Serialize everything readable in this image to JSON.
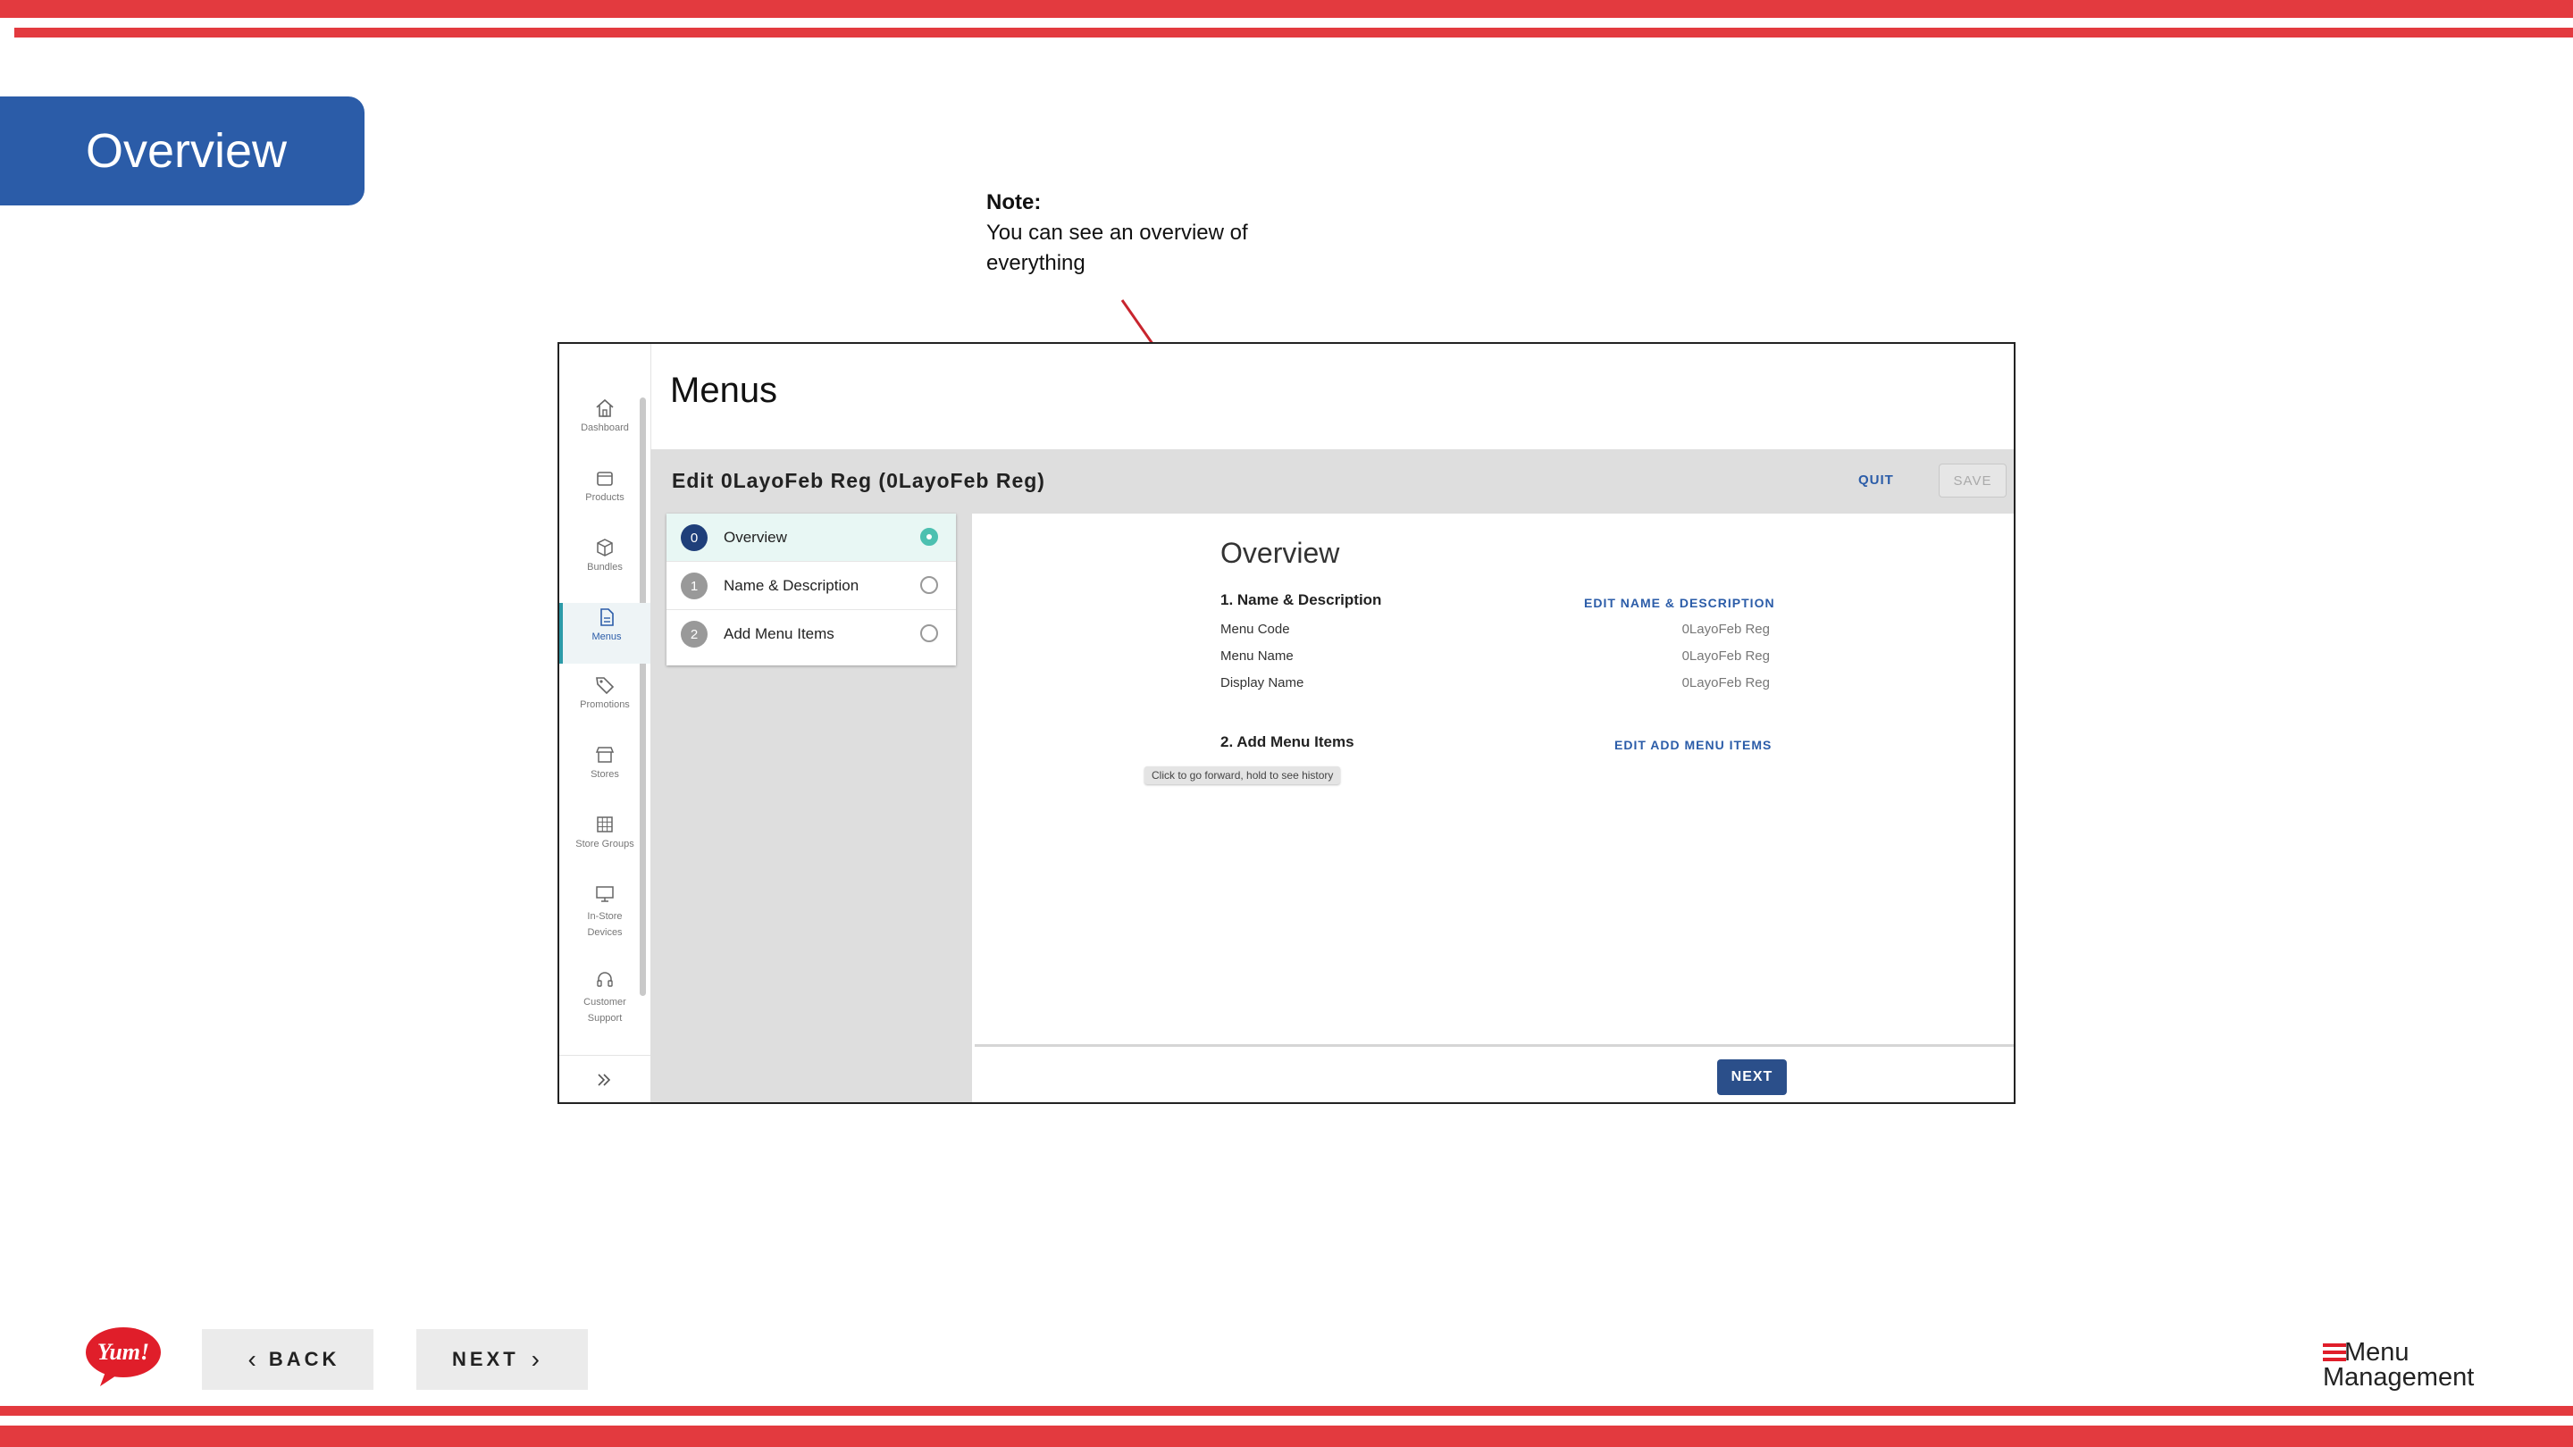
{
  "slide": {
    "title": "Overview",
    "note_heading": "Note:",
    "note_text_line1": "You can see an overview of",
    "note_text_line2": "everything"
  },
  "app": {
    "sidebar": {
      "items": [
        {
          "label": "Dashboard",
          "icon": "home-icon"
        },
        {
          "label": "Products",
          "icon": "box-icon"
        },
        {
          "label": "Bundles",
          "icon": "cube-icon"
        },
        {
          "label": "Menus",
          "icon": "document-icon"
        },
        {
          "label": "Promotions",
          "icon": "tag-icon"
        },
        {
          "label": "Stores",
          "icon": "store-icon"
        },
        {
          "label": "Store Groups",
          "icon": "grid-icon"
        },
        {
          "label_line1": "In-Store",
          "label_line2": "Devices",
          "icon": "monitor-icon"
        },
        {
          "label_line1": "Customer",
          "label_line2": "Support",
          "icon": "headset-icon"
        }
      ],
      "expand_icon": "double-chevron-right-icon"
    },
    "page_title": "Menus",
    "edit_title": "Edit 0LayoFeb Reg (0LayoFeb Reg)",
    "quit_label": "QUIT",
    "save_label": "SAVE",
    "steps": [
      {
        "num": "0",
        "label": "Overview"
      },
      {
        "num": "1",
        "label": "Name & Description"
      },
      {
        "num": "2",
        "label": "Add Menu Items"
      }
    ],
    "overview": {
      "title": "Overview",
      "section1": "1. Name & Description",
      "edit1": "EDIT NAME & DESCRIPTION",
      "fields": [
        {
          "label": "Menu Code",
          "value": "0LayoFeb Reg"
        },
        {
          "label": "Menu Name",
          "value": "0LayoFeb Reg"
        },
        {
          "label": "Display Name",
          "value": "0LayoFeb Reg"
        }
      ],
      "section2": "2. Add Menu Items",
      "edit2": "EDIT ADD MENU ITEMS"
    },
    "tooltip": "Click to go forward, hold to see history",
    "next_label": "NEXT"
  },
  "nav": {
    "back_label": "BACK",
    "next_label": "NEXT"
  },
  "logos": {
    "yum_text": "Yum!",
    "mm_line1": "Menu",
    "mm_line2": "Management"
  },
  "colors": {
    "accent_red": "#e33a3f",
    "brand_blue": "#2b5ca8",
    "active_teal": "#4cc0b0"
  }
}
